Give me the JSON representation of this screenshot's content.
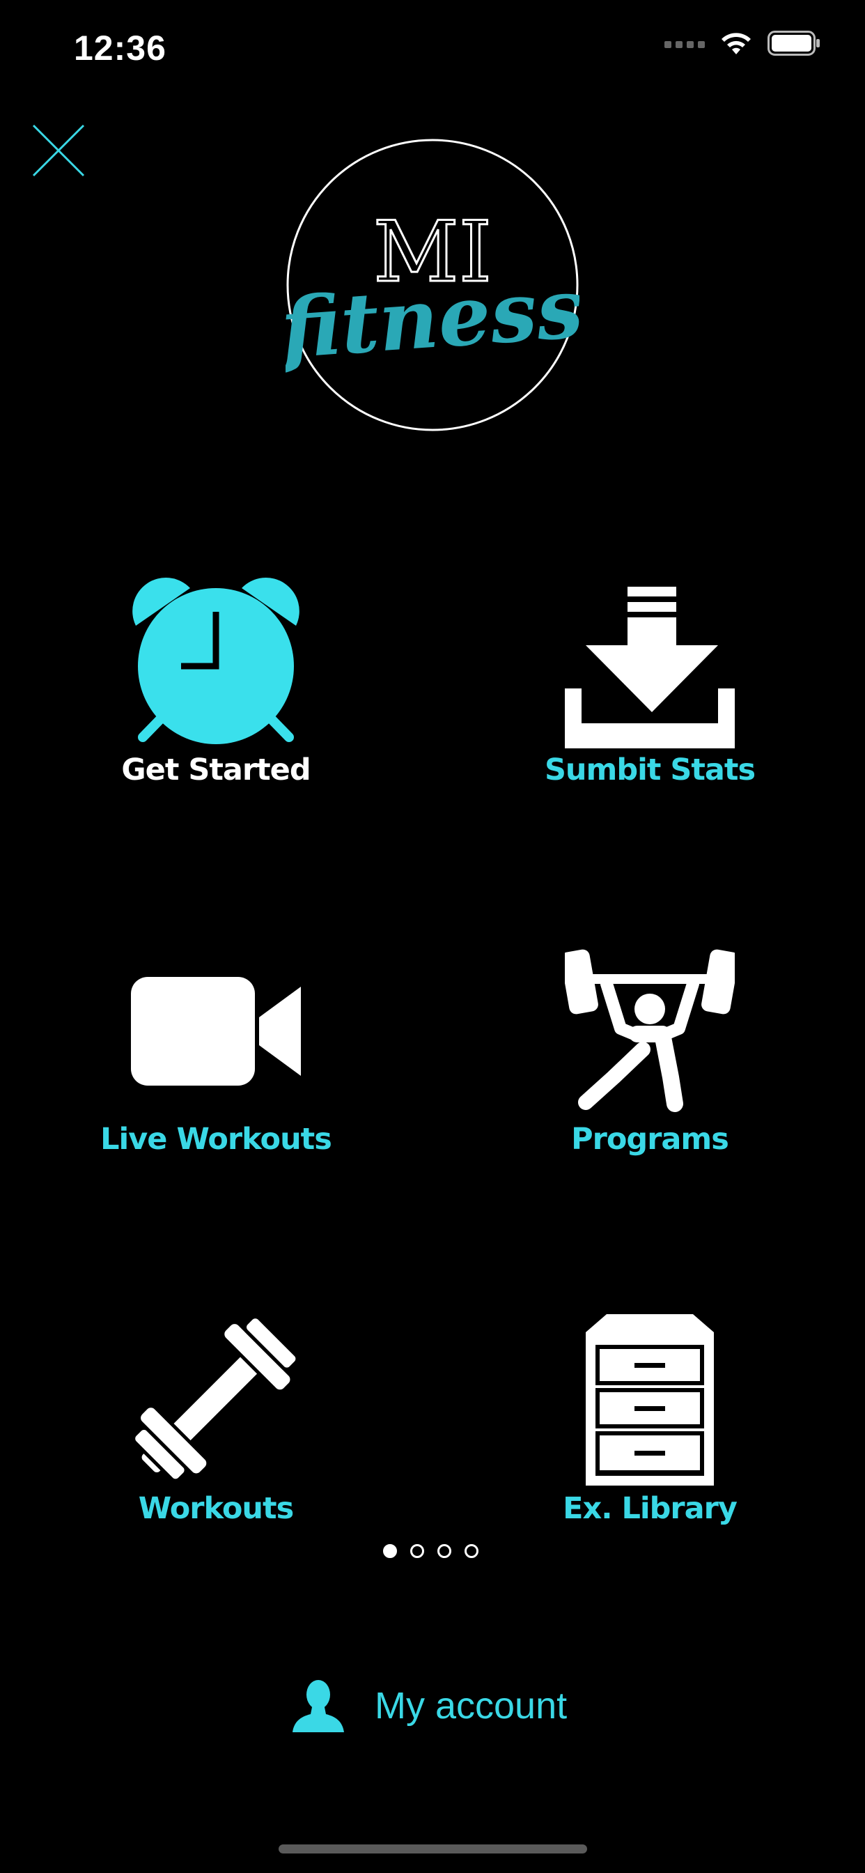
{
  "status_bar": {
    "time": "12:36",
    "icons": [
      "signal-icon",
      "wifi-icon",
      "battery-icon"
    ]
  },
  "header": {
    "close_icon": "close-icon",
    "logo": {
      "line1": "MI",
      "line2": "fitness"
    }
  },
  "menu": {
    "items": [
      {
        "label": "Get Started",
        "icon": "alarm-clock-icon",
        "label_color": "#ffffff",
        "icon_color": "#3ae0ec"
      },
      {
        "label": "Sumbit Stats",
        "icon": "download-tray-icon",
        "label_color": "#3ad8e6",
        "icon_color": "#ffffff"
      },
      {
        "label": "Live Workouts",
        "icon": "video-camera-icon",
        "label_color": "#3ad8e6",
        "icon_color": "#ffffff"
      },
      {
        "label": "Programs",
        "icon": "weightlifter-icon",
        "label_color": "#3ad8e6",
        "icon_color": "#ffffff"
      },
      {
        "label": "Workouts",
        "icon": "dumbbell-icon",
        "label_color": "#3ad8e6",
        "icon_color": "#ffffff"
      },
      {
        "label": "Ex. Library",
        "icon": "file-cabinet-icon",
        "label_color": "#3ad8e6",
        "icon_color": "#ffffff"
      }
    ]
  },
  "pager": {
    "pages": 4,
    "current": 1
  },
  "account": {
    "label": "My account",
    "icon": "user-icon"
  },
  "colors": {
    "accent": "#3ad8e6",
    "background": "#000000"
  }
}
